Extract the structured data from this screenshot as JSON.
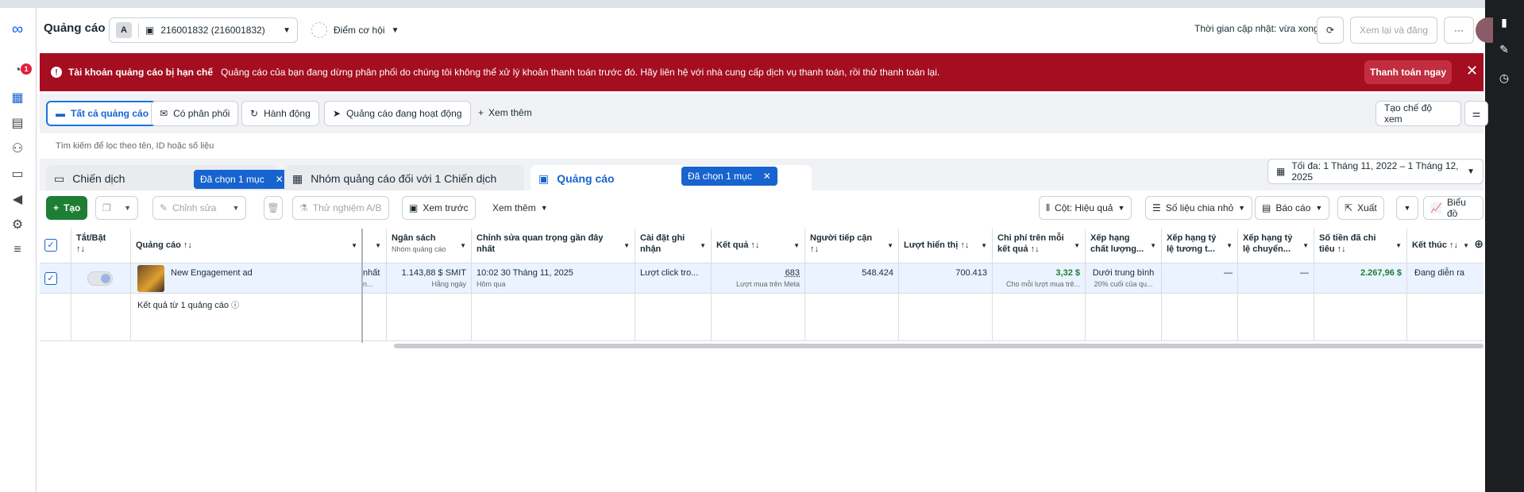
{
  "nav": {
    "notification_count": "1"
  },
  "header": {
    "title": "Quảng cáo",
    "account_initial": "A",
    "account_label": "216001832 (216001832)",
    "opportunity_label": "Điểm cơ hội",
    "updated_text": "Thời gian cập nhật: vừa xong",
    "review_publish": "Xem lại và đăng",
    "more": "···"
  },
  "alert": {
    "title": "Tài khoản quảng cáo bị hạn chế",
    "message": "Quảng cáo của bạn đang dừng phân phối do chúng tôi không thể xử lý khoản thanh toán trước đó. Hãy liên hệ với nhà cung cấp dịch vụ thanh toán, rồi thử thanh toán lại.",
    "pay_now": "Thanh toán ngay"
  },
  "filters": {
    "items": [
      "Tất cả quảng cáo",
      "Có phân phối",
      "Hành động",
      "Quảng cáo đang hoạt động"
    ],
    "see_more": "Xem thêm",
    "create_view": "Tạo chế độ xem"
  },
  "search": {
    "placeholder": "Tìm kiếm để lọc theo tên, ID hoặc số liệu"
  },
  "tabs": {
    "campaign": "Chiến dịch",
    "campaign_selected": "Đã chọn 1 mục",
    "adset": "Nhóm quảng cáo đối với 1 Chiến dịch",
    "ads": "Quảng cáo",
    "ads_selected": "Đã chọn 1 mục"
  },
  "date_range": "Tối đa: 1 Tháng 11, 2022 – 1 Tháng 12, 2025",
  "toolbar": {
    "create": "Tạo",
    "edit": "Chỉnh sửa",
    "ab_test": "Thử nghiệm A/B",
    "preview": "Xem trước",
    "see_more": "Xem thêm",
    "columns": "Cột: Hiệu quả",
    "breakdown": "Số liệu chia nhỏ",
    "reports": "Báo cáo",
    "export": "Xuất",
    "chart": "Biểu đồ"
  },
  "table": {
    "headers": {
      "toggle": "Tắt/Bật",
      "toggle_sort": "↑↓",
      "ad": "Quảng cáo ↑↓",
      "budget": "Ngân sách",
      "budget_sub": "Nhóm quảng cáo",
      "last_edit": "Chỉnh sửa quan trọng gần đây nhất",
      "attribution": "Cài đặt ghi nhận",
      "results": "Kết quả ↑↓",
      "reach": "Người tiếp cận",
      "reach_sort": "↑↓",
      "impressions": "Lượt hiển thị ↑↓",
      "cost_per_result": "Chi phí trên mỗi kết quả ↑↓",
      "quality": "Xếp hạng chất lượng...",
      "engagement_rank": "Xếp hạng tỷ lệ tương t...",
      "conversion_rank": "Xếp hạng tỷ lệ chuyển...",
      "spent": "Số tiền đã chi tiêu ↑↓",
      "ends": "Kết thúc ↑↓"
    },
    "row": {
      "name": "New Engagement ad",
      "partial_col": "nhất",
      "partial_sub": "n...",
      "budget": "1.143,88 $ SMIT",
      "budget_sub": "Hằng ngày",
      "last_edit": "10:02 30 Tháng 11, 2025",
      "last_edit_sub": "Hôm qua",
      "attribution": "Lượt click tro...",
      "results": "683",
      "results_sub": "Lượt mua trên Meta",
      "reach": "548.424",
      "impressions": "700.413",
      "cost_per_result": "3,32 $",
      "cost_sub": "Cho mỗi lượt mua trê...",
      "quality": "Dưới trung bình",
      "quality_sub": "20% cuối của qu...",
      "engagement_rank": "—",
      "conversion_rank": "—",
      "spent": "2.267,96 $",
      "ends": "Đang diễn ra"
    },
    "footer": "Kết quả từ 1 quảng cáo"
  }
}
